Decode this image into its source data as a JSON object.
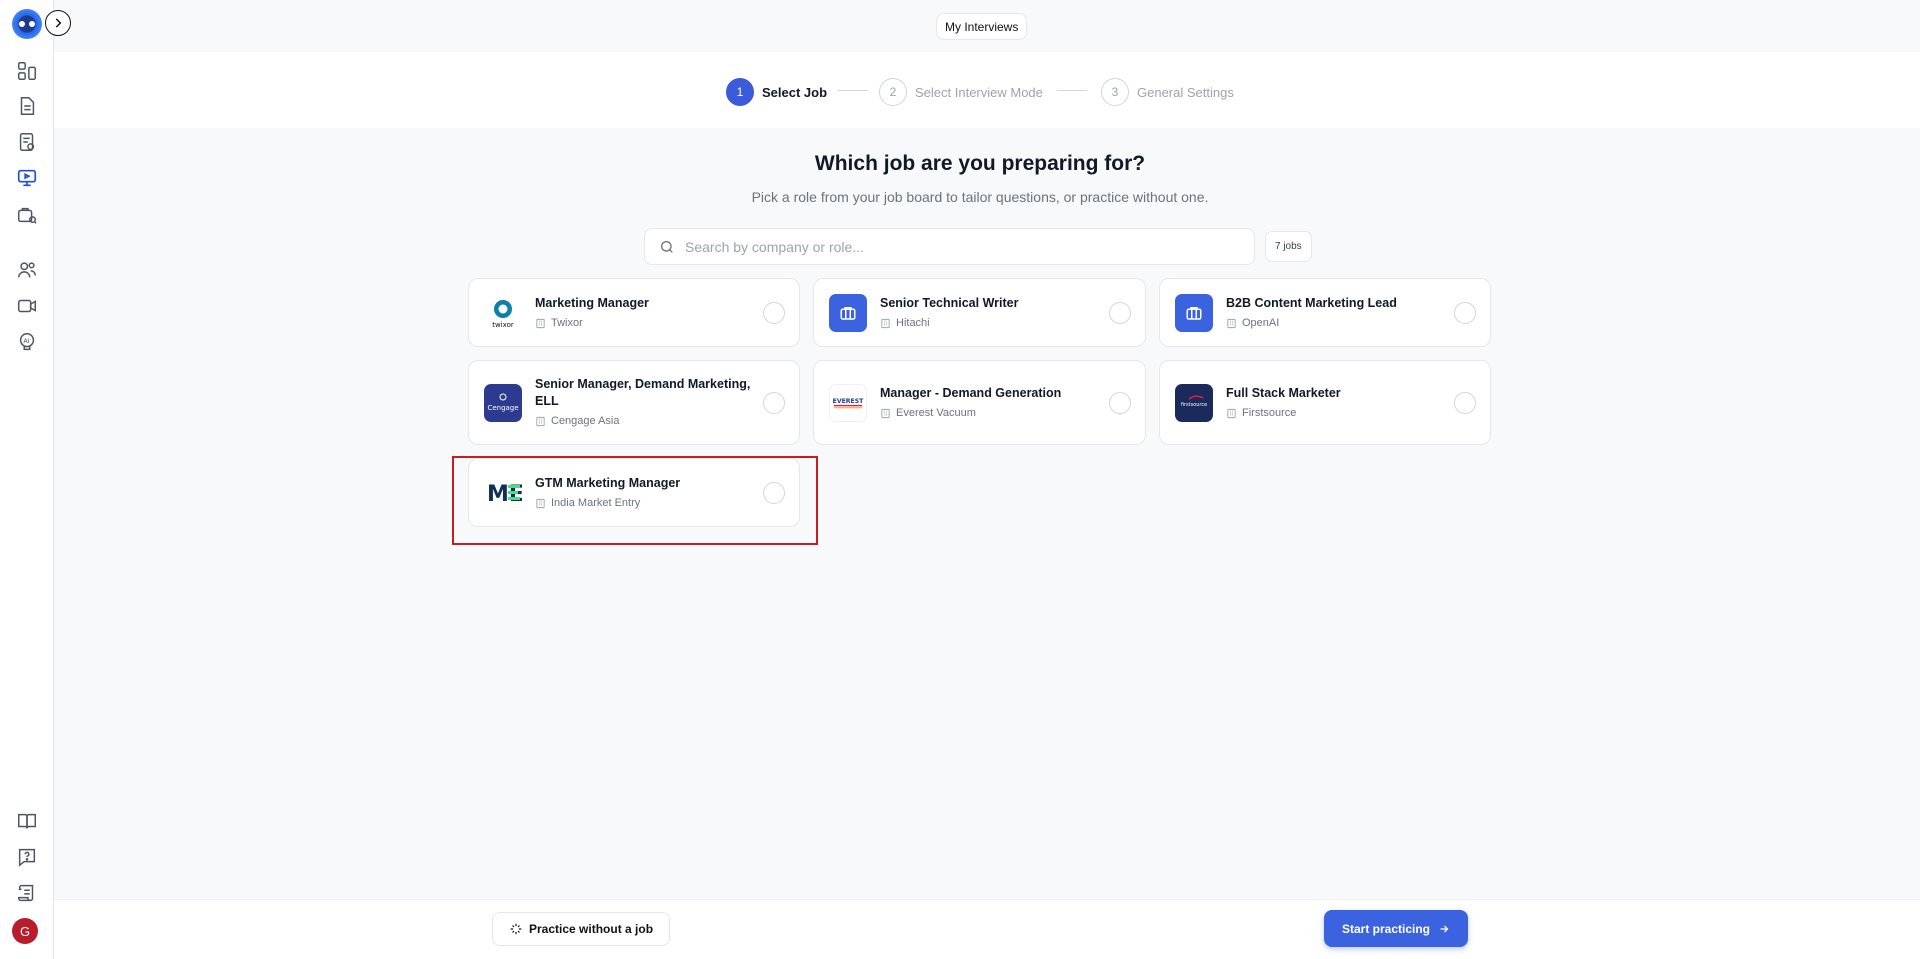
{
  "topbar": {
    "my_interviews_label": "My Interviews"
  },
  "stepper": {
    "steps": [
      {
        "num": "1",
        "label": "Select Job",
        "state": "active"
      },
      {
        "num": "2",
        "label": "Select Interview Mode",
        "state": "inactive"
      },
      {
        "num": "3",
        "label": "General Settings",
        "state": "inactive"
      }
    ]
  },
  "main": {
    "heading": "Which job are you preparing for?",
    "subheading": "Pick a role from your job board to tailor questions, or practice without one.",
    "search_placeholder": "Search by company or role...",
    "jobs_count": "7 jobs"
  },
  "jobs": [
    {
      "title": "Marketing Manager",
      "company": "Twixor",
      "logo": "twixor-logo",
      "logo_text": "twixor"
    },
    {
      "title": "Senior Technical Writer",
      "company": "Hitachi",
      "logo": "briefcase-icon"
    },
    {
      "title": "B2B Content Marketing Lead",
      "company": "OpenAI",
      "logo": "briefcase-icon"
    },
    {
      "title": "Senior Manager, Demand Marketing, ELL",
      "company": "Cengage Asia",
      "logo": "cengage-logo",
      "logo_text": "Cengage"
    },
    {
      "title": "Manager - Demand Generation",
      "company": "Everest Vacuum",
      "logo": "everest-logo",
      "logo_text": "EVEREST"
    },
    {
      "title": "Full Stack Marketer",
      "company": "Firstsource",
      "logo": "firstsource-logo",
      "logo_text": "firstsource"
    },
    {
      "title": "GTM Marketing Manager",
      "company": "India Market Entry",
      "logo": "me-logo",
      "logo_text": "ME"
    }
  ],
  "footer": {
    "practice_without_job_label": "Practice without a job",
    "start_practicing_label": "Start practicing"
  },
  "user": {
    "avatar_initial": "G"
  },
  "colors": {
    "accent": "#3b63e0",
    "highlight_border": "#c81e1e",
    "avatar": "#b91c2c"
  }
}
